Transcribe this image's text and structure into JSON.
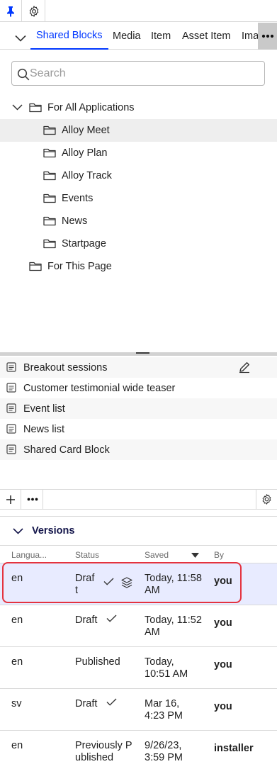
{
  "tabs": [
    "Shared Blocks",
    "Media",
    "Item",
    "Asset Item",
    "Ima"
  ],
  "search": {
    "placeholder": "Search",
    "value": ""
  },
  "tree": {
    "root": "For All Applications",
    "children": [
      "Alloy Meet",
      "Alloy Plan",
      "Alloy Track",
      "Events",
      "News",
      "Startpage"
    ],
    "sibling": "For This Page"
  },
  "blocks": [
    "Breakout sessions",
    "Customer testimonial wide teaser",
    "Event list",
    "News list",
    "Shared Card Block"
  ],
  "versions": {
    "title": "Versions",
    "headers": {
      "language": "Langua...",
      "status": "Status",
      "saved": "Saved",
      "by": "By"
    },
    "rows": [
      {
        "language": "en",
        "status_l1": "Draf",
        "status_l2": "t",
        "saved_l1": "Today, 11:58",
        "saved_l2": "AM",
        "by": "you"
      },
      {
        "language": "en",
        "status_l1": "Draft",
        "status_l2": "",
        "saved_l1": "Today, 11:52",
        "saved_l2": "AM",
        "by": "you"
      },
      {
        "language": "en",
        "status_l1": "Published",
        "status_l2": "",
        "saved_l1": "Today,",
        "saved_l2": "10:51 AM",
        "by": "you"
      },
      {
        "language": "sv",
        "status_l1": "Draft",
        "status_l2": "",
        "saved_l1": "Mar 16,",
        "saved_l2": "4:23 PM",
        "by": "you"
      },
      {
        "language": "en",
        "status_l1": "Previously P",
        "status_l2": "ublished",
        "saved_l1": "9/26/23,",
        "saved_l2": "3:59 PM",
        "by": "installer"
      }
    ]
  },
  "icons": {
    "pin": "pin-icon",
    "settings": "gear-icon",
    "collapse": "chevron-down-icon",
    "more": "ellipsis-icon",
    "search": "search-icon",
    "folder": "folder-icon",
    "block": "block-icon",
    "edit": "pencil-icon",
    "add": "plus-icon",
    "check": "check-icon",
    "layers": "layers-icon",
    "sort": "sort-down-icon"
  },
  "colors": {
    "accent": "#0037ff",
    "selected_row": "#e8ebff",
    "highlight": "#e4333f",
    "versions_title": "#13154a"
  }
}
